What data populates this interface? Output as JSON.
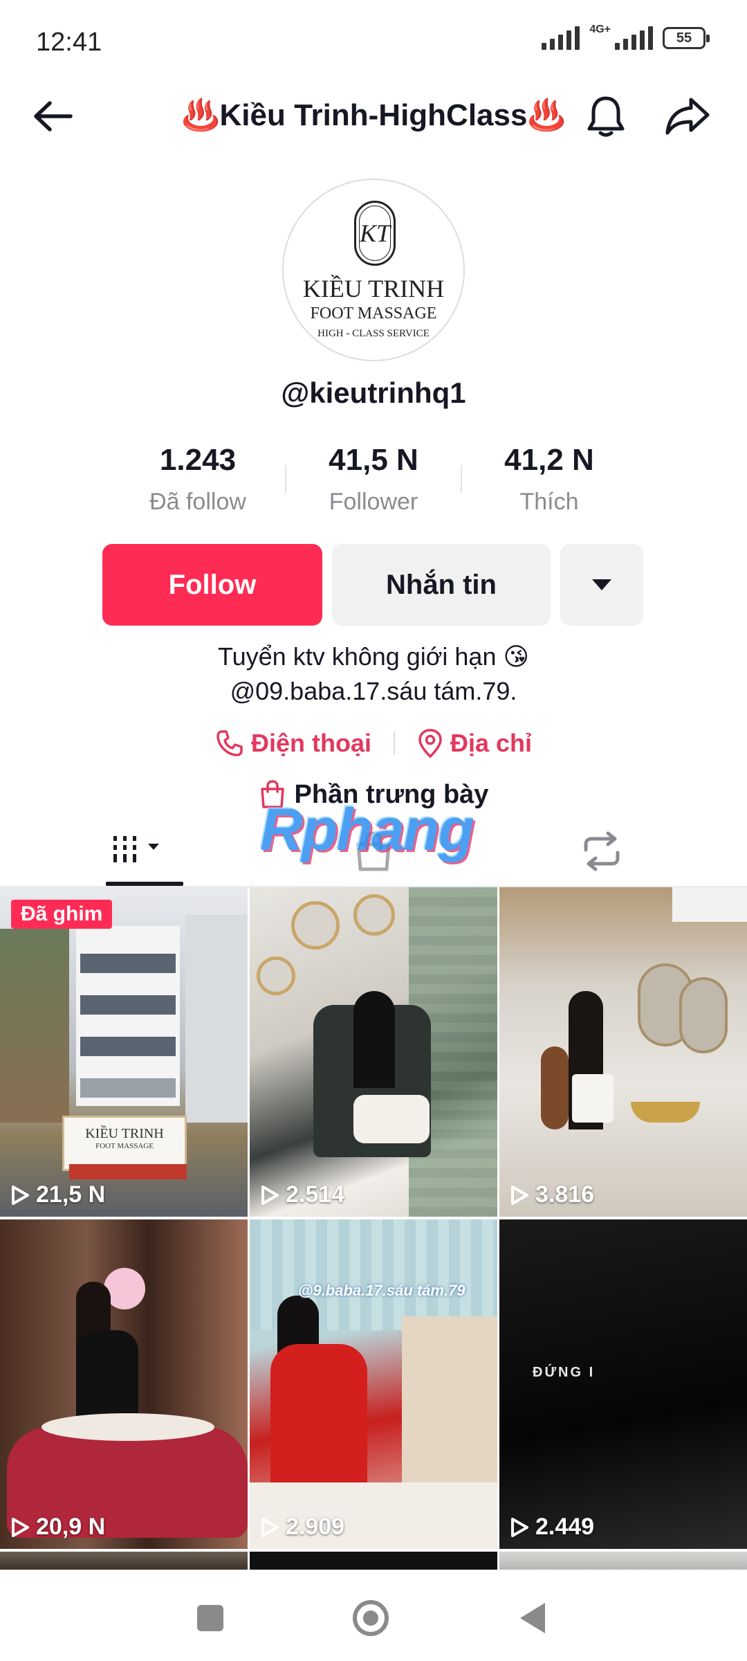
{
  "status_bar": {
    "time": "12:41",
    "network": "4G+",
    "battery": "55"
  },
  "header": {
    "title": "♨️Kiều Trinh-HighClass♨️",
    "icons": [
      "back-arrow-icon",
      "bell-icon",
      "share-icon"
    ]
  },
  "profile": {
    "avatar": {
      "monogram": "KT",
      "name": "KIỀU TRINH",
      "subtitle": "FOOT MASSAGE",
      "tagline": "HIGH - CLASS SERVICE"
    },
    "username": "@kieutrinhq1",
    "stats": [
      {
        "value": "1.243",
        "label": "Đã follow"
      },
      {
        "value": "41,5 N",
        "label": "Follower"
      },
      {
        "value": "41,2 N",
        "label": "Thích"
      }
    ],
    "buttons": {
      "follow": "Follow",
      "message": "Nhắn tin"
    },
    "bio_line1": "Tuyển ktv không giới hạn 😘",
    "bio_line2": "@09.baba.17.sáu tám.79.",
    "contact": {
      "phone": "Điện thoại",
      "address": "Địa chỉ"
    },
    "showcase": "Phần trưng bày"
  },
  "watermark": "Rphang",
  "tabs": [
    "videos-tab",
    "shop-tab",
    "reposts-tab"
  ],
  "colors": {
    "accent": "#fe2c55",
    "link": "#e2385e",
    "text": "#161823",
    "muted": "#8a8b91"
  },
  "videos": [
    {
      "views": "21,5 N",
      "pinned": "Đã ghim",
      "sign_text": "KIỀU TRINH",
      "sign_sub": "FOOT MASSAGE"
    },
    {
      "views": "2.514"
    },
    {
      "views": "3.816"
    },
    {
      "views": "20,9 N"
    },
    {
      "views": "2.909",
      "caption": "@9.baba.17.sáu tám.79"
    },
    {
      "views": "2.449",
      "caption": "ĐỨNG I"
    }
  ]
}
